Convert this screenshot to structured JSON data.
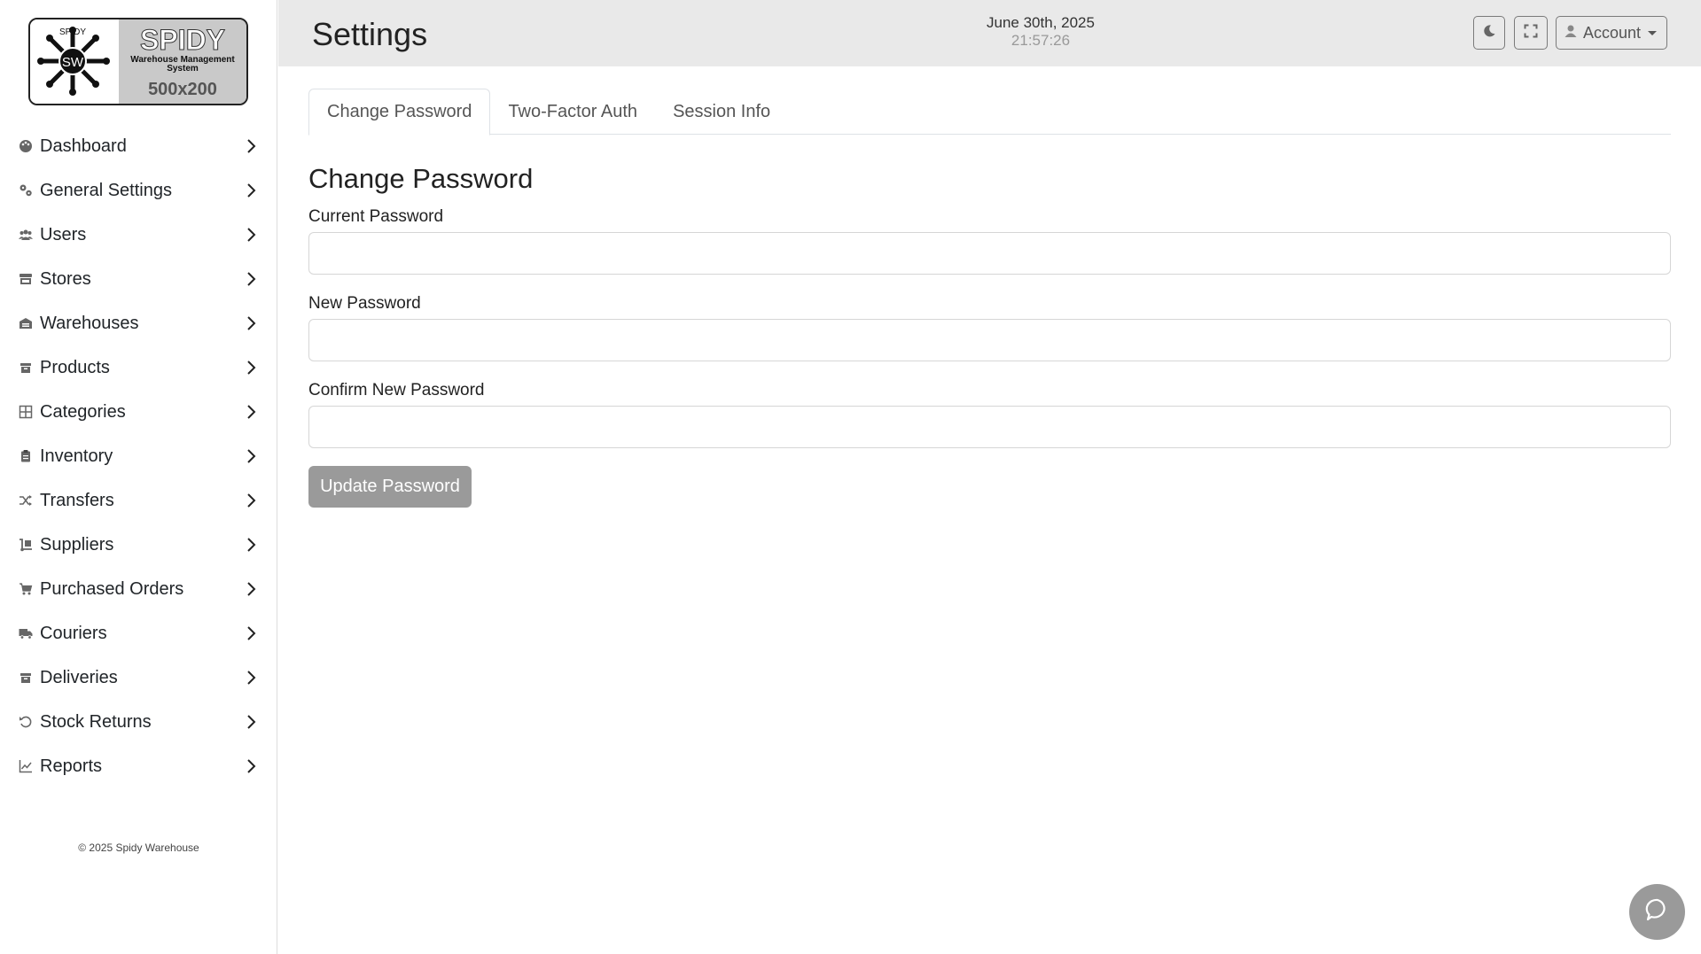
{
  "brand": {
    "logo_small": "SPIDY",
    "logo_title": "SPIDY",
    "logo_subtitle_1": "Warehouse Management",
    "logo_subtitle_2": "System",
    "logo_monogram": "SW",
    "logo_size_text": "500x200"
  },
  "sidebar": {
    "items": [
      {
        "label": "Dashboard",
        "icon": "palette-icon"
      },
      {
        "label": "General Settings",
        "icon": "gears-icon"
      },
      {
        "label": "Users",
        "icon": "users-icon"
      },
      {
        "label": "Stores",
        "icon": "store-icon"
      },
      {
        "label": "Warehouses",
        "icon": "warehouse-icon"
      },
      {
        "label": "Products",
        "icon": "box-icon"
      },
      {
        "label": "Categories",
        "icon": "grid-icon"
      },
      {
        "label": "Inventory",
        "icon": "clipboard-icon"
      },
      {
        "label": "Transfers",
        "icon": "shuffle-icon"
      },
      {
        "label": "Suppliers",
        "icon": "dolly-icon"
      },
      {
        "label": "Purchased Orders",
        "icon": "cart-icon"
      },
      {
        "label": "Couriers",
        "icon": "truck-icon"
      },
      {
        "label": "Deliveries",
        "icon": "box-icon"
      },
      {
        "label": "Stock Returns",
        "icon": "undo-icon"
      },
      {
        "label": "Reports",
        "icon": "chart-line-icon"
      }
    ],
    "copyright": "© 2025 Spidy Warehouse"
  },
  "header": {
    "title": "Settings",
    "date": "June 30th, 2025",
    "time": "21:57:26",
    "account_label": "Account"
  },
  "main": {
    "tabs": [
      {
        "label": "Change Password",
        "active": true
      },
      {
        "label": "Two-Factor Auth",
        "active": false
      },
      {
        "label": "Session Info",
        "active": false
      }
    ],
    "section_title": "Change Password",
    "fields": {
      "current_label": "Current Password",
      "current_value": "",
      "new_label": "New Password",
      "new_value": "",
      "confirm_label": "Confirm New Password",
      "confirm_value": ""
    },
    "submit_label": "Update Password"
  },
  "colors": {
    "header_bg": "#e9e9e9",
    "button_disabled": "#9a9a9a",
    "border": "#dee2e6"
  }
}
